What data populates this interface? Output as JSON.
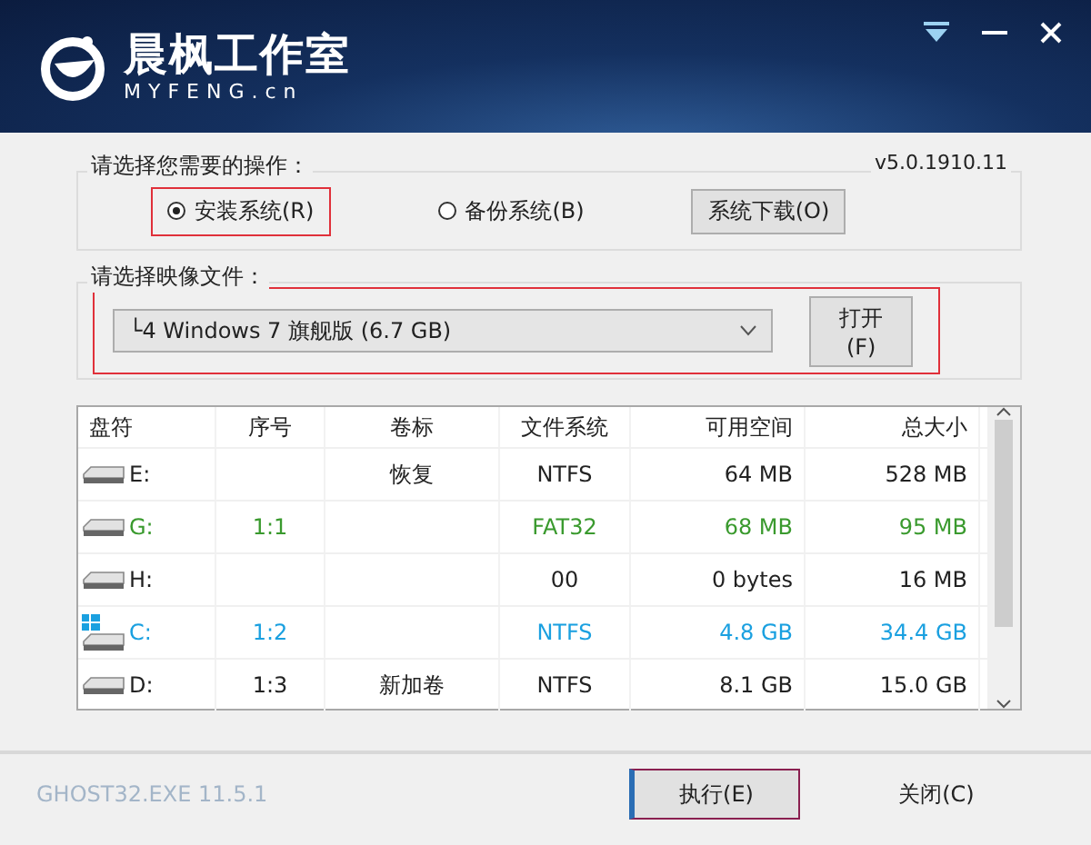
{
  "header": {
    "brand": "晨枫工作室",
    "domain": "MYFENG.cn"
  },
  "operation": {
    "label": "请选择您需要的操作：",
    "version": "v5.0.1910.11",
    "options": [
      {
        "label": "安装系统(R)",
        "selected": true
      },
      {
        "label": "备份系统(B)",
        "selected": false
      }
    ],
    "download_button": "系统下载(O)"
  },
  "image_file": {
    "label": "请选择映像文件：",
    "value": "└4 Windows 7 旗舰版 (6.7 GB)",
    "open_button": "打开(F)"
  },
  "table": {
    "columns": [
      "盘符",
      "序号",
      "卷标",
      "文件系统",
      "可用空间",
      "总大小"
    ],
    "rows": [
      {
        "kind": "disk",
        "color": "#222222",
        "cells": [
          "E:",
          "",
          "恢复",
          "NTFS",
          "64 MB",
          "528 MB"
        ]
      },
      {
        "kind": "disk",
        "color": "#3a9a2e",
        "cells": [
          "G:",
          "1:1",
          "",
          "FAT32",
          "68 MB",
          "95 MB"
        ]
      },
      {
        "kind": "disk",
        "color": "#222222",
        "cells": [
          "H:",
          "",
          "",
          "00",
          "0 bytes",
          "16 MB"
        ]
      },
      {
        "kind": "system",
        "color": "#1aa0e0",
        "cells": [
          "C:",
          "1:2",
          "",
          "NTFS",
          "4.8 GB",
          "34.4 GB"
        ]
      },
      {
        "kind": "disk",
        "color": "#222222",
        "cells": [
          "D:",
          "1:3",
          "新加卷",
          "NTFS",
          "8.1 GB",
          "15.0 GB"
        ]
      }
    ]
  },
  "footer": {
    "engine": "GHOST32.EXE 11.5.1",
    "execute_button": "执行(E)",
    "close_button": "关闭(C)"
  }
}
